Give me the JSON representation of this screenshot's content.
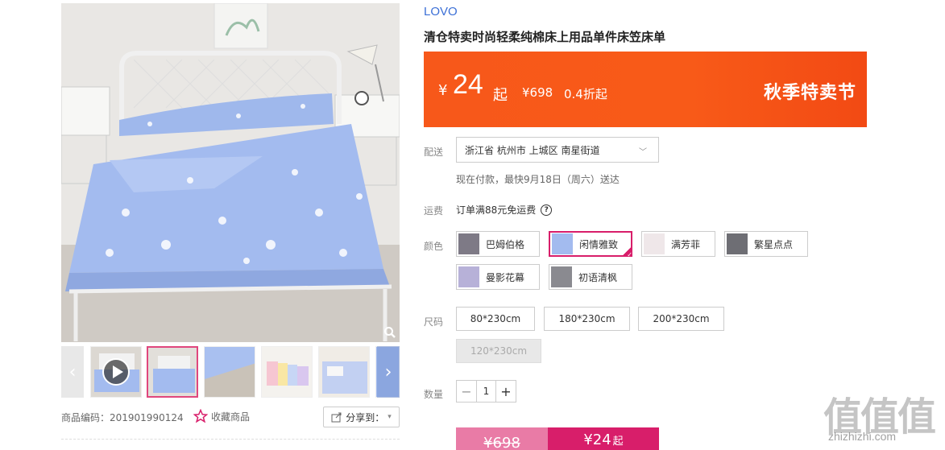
{
  "brand": "LOVO",
  "title": "清仓特卖时尚轻柔纯棉床上用品单件床笠床单",
  "price": {
    "currency": "¥",
    "value": "24",
    "suffix": "起",
    "original": "¥698",
    "discount": "0.4折起",
    "event": "秋季特卖节"
  },
  "delivery": {
    "label": "配送",
    "address": "浙江省 杭州市 上城区 南星街道",
    "note": "现在付款，最快9月18日（周六）送达"
  },
  "shipping": {
    "label": "运费",
    "text": "订单满88元免运费",
    "help": "?"
  },
  "colors": {
    "label": "颜色",
    "options": [
      {
        "name": "巴姆伯格",
        "selected": false
      },
      {
        "name": "闲情雅致",
        "selected": true
      },
      {
        "name": "满芳菲",
        "selected": false
      },
      {
        "name": "繁星点点",
        "selected": false
      },
      {
        "name": "曼影花幕",
        "selected": false
      },
      {
        "name": "初语清枫",
        "selected": false
      }
    ]
  },
  "sizes": {
    "label": "尺码",
    "options": [
      {
        "name": "80*230cm",
        "disabled": false
      },
      {
        "name": "180*230cm",
        "disabled": false
      },
      {
        "name": "200*230cm",
        "disabled": false
      },
      {
        "name": "120*230cm",
        "disabled": true
      }
    ]
  },
  "quantity": {
    "label": "数量",
    "value": "1",
    "minus": "−",
    "plus": "+"
  },
  "buy": {
    "original": "¥698",
    "price": "¥24",
    "suffix": "起"
  },
  "gallery": {
    "product_code": "商品编码：201901990124",
    "favorite": "收藏商品",
    "share": "分享到：",
    "prev": "‹",
    "next": "›"
  },
  "watermark": {
    "glyphs": "值值值",
    "url": "zhizhizhi.com"
  },
  "colors_theme": {
    "accent": "#d81e6a",
    "banner": "#f7581a",
    "brand_link": "#3b6fd6"
  }
}
